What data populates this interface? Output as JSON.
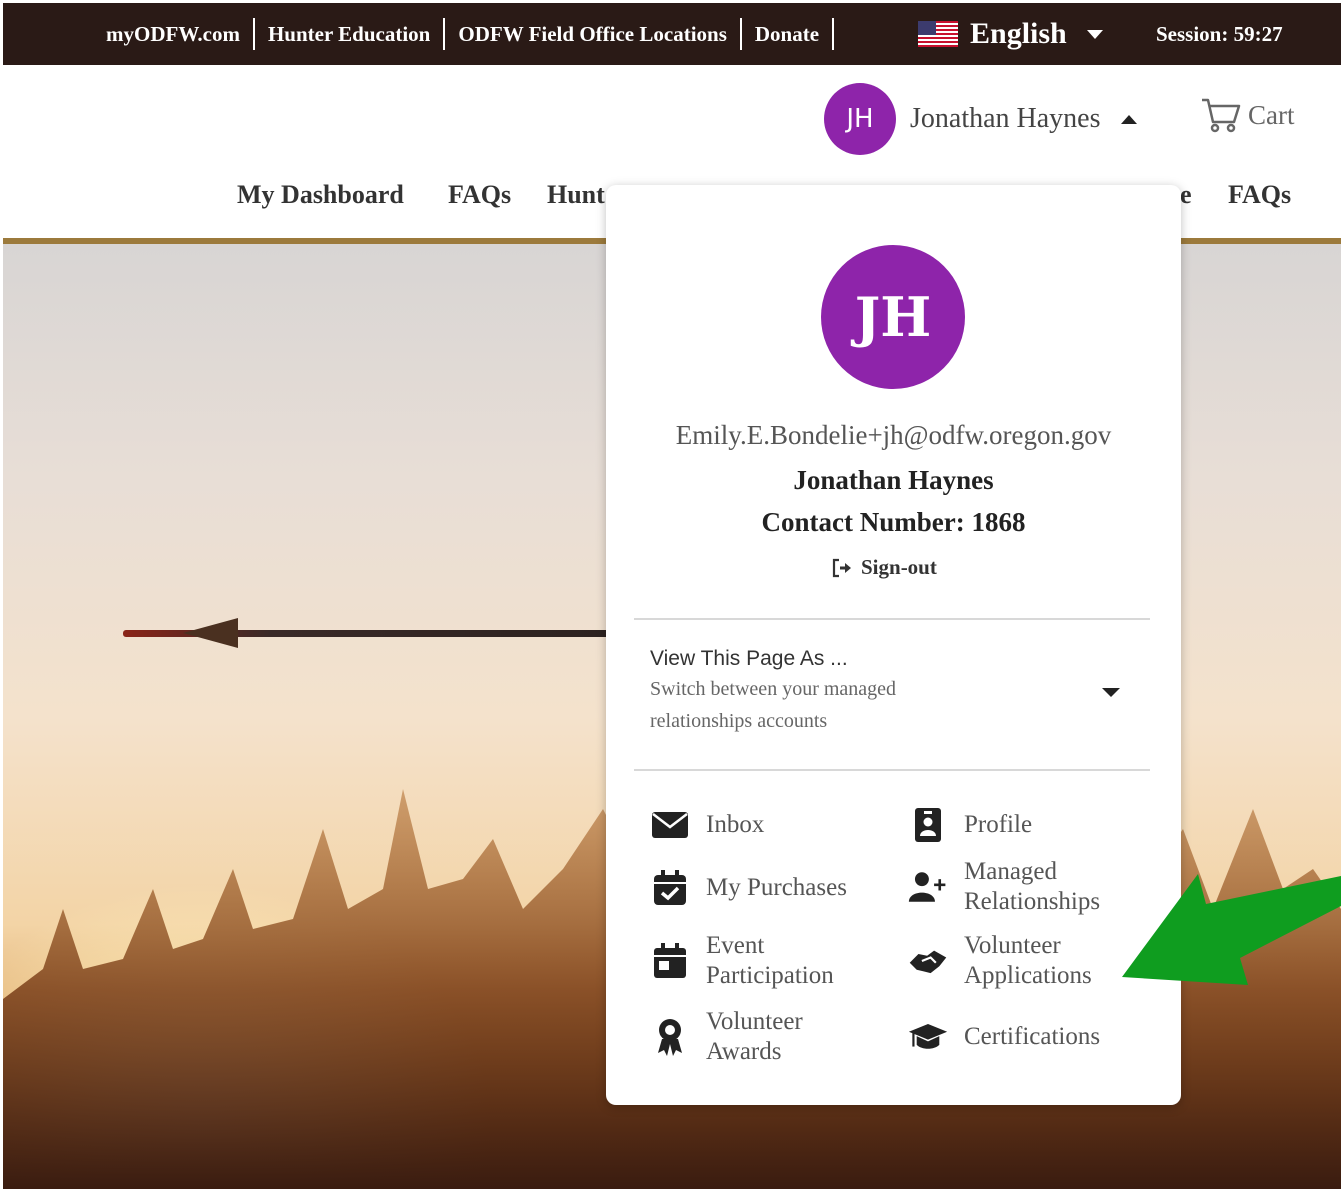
{
  "topbar": {
    "links": [
      "myODFW.com",
      "Hunter Education",
      "ODFW Field Office Locations",
      "Donate"
    ],
    "language": "English",
    "session": "Session: 59:27"
  },
  "user": {
    "initials": "JH",
    "name": "Jonathan Haynes",
    "cart_label": "Cart",
    "avatar_color": "#8e24aa"
  },
  "nav": {
    "items": [
      "My Dashboard",
      "FAQs",
      "Hunt",
      "e",
      "FAQs"
    ]
  },
  "panel": {
    "initials": "JH",
    "email": "Emily.E.Bondelie+jh@odfw.oregon.gov",
    "name": "Jonathan Haynes",
    "contact": "Contact Number: 1868",
    "signout": "Sign-out",
    "view_as_title": "View This Page As ...",
    "view_as_subtitle": "Switch between your managed relationships accounts",
    "menu": {
      "inbox": "Inbox",
      "profile": "Profile",
      "purchases": "My Purchases",
      "managed": "Managed Relationships",
      "event": "Event Participation",
      "vol_apps": "Volunteer Applications",
      "vol_awards": "Volunteer Awards",
      "certs": "Certifications"
    }
  },
  "icons": {
    "topbar": [
      "us-flag-icon",
      "caret-down-icon"
    ],
    "header": [
      "caret-up-icon",
      "cart-icon"
    ],
    "panel": [
      "sign-out-icon",
      "caret-down-icon",
      "envelope-icon",
      "id-badge-icon",
      "calendar-check-icon",
      "user-plus-icon",
      "calendar-icon",
      "handshake-icon",
      "award-icon",
      "graduation-cap-icon"
    ],
    "annotation": [
      "green-arrow-icon"
    ]
  },
  "colors": {
    "topbar_bg": "#2a1a16",
    "gold_rule": "#9c7a3c",
    "annotation_arrow": "#0f9d1f"
  }
}
